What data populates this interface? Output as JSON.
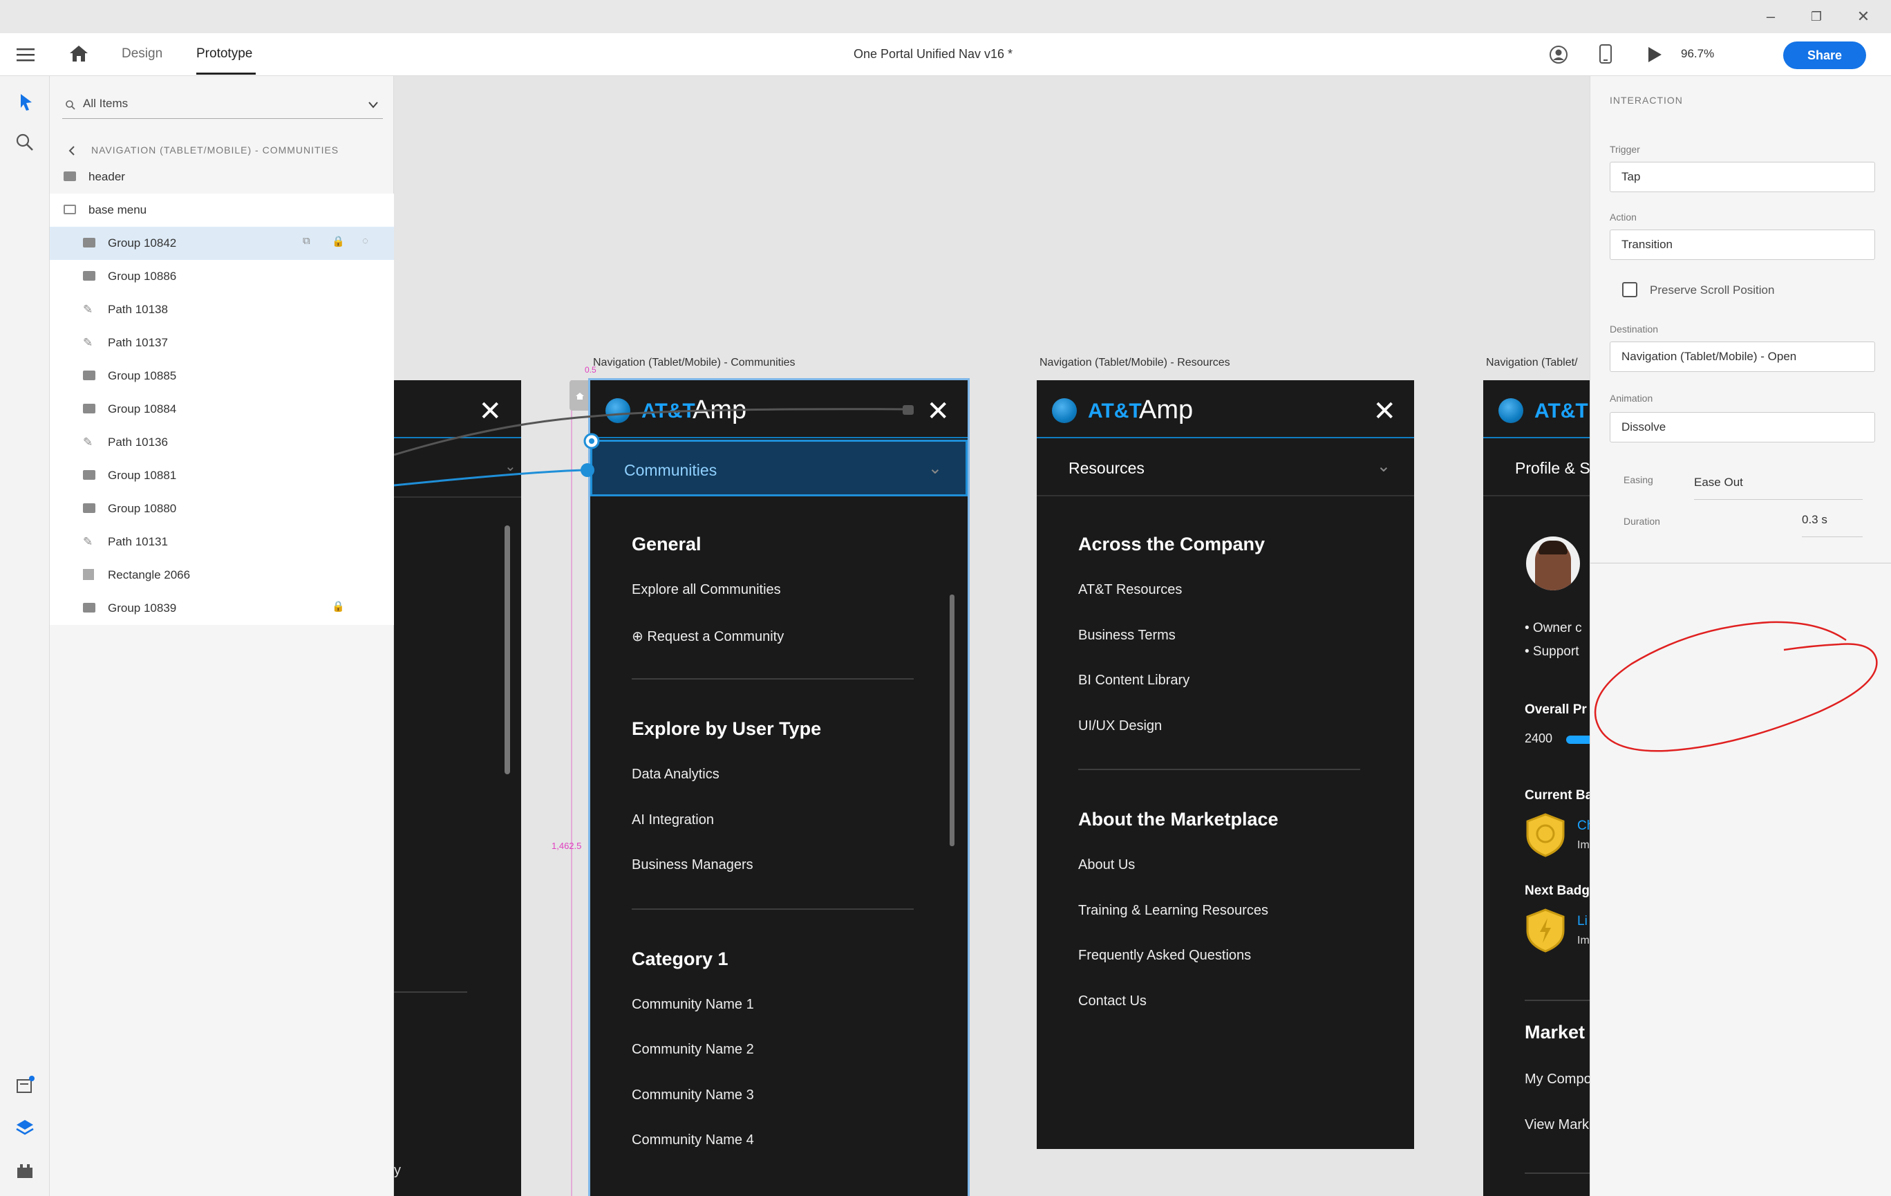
{
  "window": {
    "minimize_glyph": "–",
    "restore_glyph": "❐",
    "close_glyph": "✕"
  },
  "toolbar": {
    "tabs": [
      "Design",
      "Prototype"
    ],
    "active_tab": "Prototype",
    "document_title": "One Portal Unified Nav v16 *",
    "zoom": "96.7%",
    "share_label": "Share",
    "icons": [
      "menu-icon",
      "home-icon",
      "user-icon",
      "mobile-preview-icon",
      "play-icon"
    ]
  },
  "left_tools": [
    "select-arrow-icon",
    "search-icon",
    "assets-icon",
    "layers-icon",
    "plugins-icon"
  ],
  "layers": {
    "search_placeholder": "All Items",
    "breadcrumb": "NAVIGATION (TABLET/MOBILE) - COMMUNITIES",
    "items": [
      {
        "label": "header",
        "type": "folder"
      },
      {
        "label": "base menu",
        "type": "folder-open"
      },
      {
        "label": "Group 10842",
        "type": "folder",
        "selected": true
      },
      {
        "label": "Group 10886",
        "type": "folder"
      },
      {
        "label": "Path 10138",
        "type": "path"
      },
      {
        "label": "Path 10137",
        "type": "path"
      },
      {
        "label": "Group 10885",
        "type": "folder"
      },
      {
        "label": "Group 10884",
        "type": "folder"
      },
      {
        "label": "Path 10136",
        "type": "path"
      },
      {
        "label": "Group 10881",
        "type": "folder"
      },
      {
        "label": "Group 10880",
        "type": "folder"
      },
      {
        "label": "Path 10131",
        "type": "path"
      },
      {
        "label": "Rectangle 2066",
        "type": "rect"
      },
      {
        "label": "Group 10839",
        "type": "folder",
        "locked": true
      }
    ]
  },
  "canvas": {
    "measure_top": "0.5",
    "measure_side": "1,462.5",
    "artboards": [
      {
        "title": "Navigation (Tablet/Mobile) - Communities",
        "brand_att": "AT&T",
        "brand_amp": "Amp",
        "selector": "Communities",
        "sections": [
          {
            "title": "General",
            "items": [
              "Explore all Communities",
              "Request a Community"
            ]
          },
          {
            "title": "Explore by User Type",
            "items": [
              "Data Analytics",
              "AI Integration",
              "Business Managers"
            ]
          },
          {
            "title": "Category 1",
            "items": [
              "Community Name 1",
              "Community Name 2",
              "Community Name 3",
              "Community Name 4"
            ]
          }
        ]
      },
      {
        "title": "Navigation (Tablet/Mobile) - Resources",
        "brand_att": "AT&T",
        "brand_amp": "Amp",
        "selector": "Resources",
        "sections": [
          {
            "title": "Across the Company",
            "items": [
              "AT&T Resources",
              "Business Terms",
              "BI Content Library",
              "UI/UX Design"
            ]
          },
          {
            "title": "About the Marketplace",
            "items": [
              "About Us",
              "Training & Learning Resources",
              "Frequently Asked Questions",
              "Contact Us"
            ]
          }
        ]
      },
      {
        "title": "Navigation (Tablet/",
        "brand_att": "AT&T",
        "selector": "Profile & S",
        "bullets": [
          "• Owner c",
          "• Support"
        ],
        "overall_label": "Overall Pr",
        "overall_value": "2400",
        "current_badge": "Current Ba",
        "current_badge_name": "Ch",
        "current_badge_sub": "Im",
        "next_badge": "Next Badg",
        "next_badge_name": "Li",
        "next_badge_sub": "Im",
        "market_title": "Market",
        "market_items": [
          "My Compo",
          "View Mark"
        ]
      }
    ],
    "left_partial_text": "y"
  },
  "interaction": {
    "header": "INTERACTION",
    "trigger_label": "Trigger",
    "trigger": "Tap",
    "action_label": "Action",
    "action": "Transition",
    "preserve_label": "Preserve Scroll Position",
    "destination_label": "Destination",
    "destination": "Navigation (Tablet/Mobile) - Open",
    "animation_label": "Animation",
    "animation": "Dissolve",
    "easing_label": "Easing",
    "easing": "Ease Out",
    "duration_label": "Duration",
    "duration": "0.3 s"
  },
  "colors": {
    "accent": "#1473e6",
    "att_blue": "#0f7dc2",
    "artboard_bg": "#1a1a1a",
    "selection_blue": "#deebf7",
    "annotation_red": "#e02020",
    "badge_gold": "#f2c230"
  }
}
